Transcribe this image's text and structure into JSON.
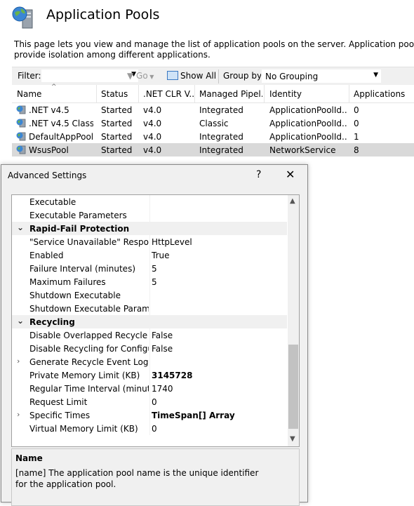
{
  "page": {
    "title": "Application Pools",
    "description_line1": "This page lets you view and manage the list of application pools on the server. Application pools are associat",
    "description_line2": "provide isolation among different applications."
  },
  "toolbar": {
    "filter_label": "Filter:",
    "filter_value": "",
    "go_label": "Go",
    "show_all_label": "Show All",
    "group_by_label": "Group by:",
    "group_by_value": "No Grouping"
  },
  "grid": {
    "columns": [
      "Name",
      "Status",
      ".NET CLR V...",
      "Managed Pipel...",
      "Identity",
      "Applications"
    ],
    "rows": [
      {
        "name": ".NET v4.5",
        "status": "Started",
        "clr": "v4.0",
        "pipeline": "Integrated",
        "identity": "ApplicationPoolId...",
        "apps": "0"
      },
      {
        "name": ".NET v4.5 Classic",
        "status": "Started",
        "clr": "v4.0",
        "pipeline": "Classic",
        "identity": "ApplicationPoolId...",
        "apps": "0"
      },
      {
        "name": "DefaultAppPool",
        "status": "Started",
        "clr": "v4.0",
        "pipeline": "Integrated",
        "identity": "ApplicationPoolId...",
        "apps": "1"
      },
      {
        "name": "WsusPool",
        "status": "Started",
        "clr": "v4.0",
        "pipeline": "Integrated",
        "identity": "NetworkService",
        "apps": "8"
      }
    ]
  },
  "dialog": {
    "title": "Advanced Settings",
    "help_glyph": "?",
    "close_glyph": "✕",
    "properties": [
      {
        "name": "Executable",
        "value": ""
      },
      {
        "name": "Executable Parameters",
        "value": ""
      },
      {
        "name": "Rapid-Fail Protection",
        "value": "",
        "category": true,
        "expander": "⌄"
      },
      {
        "name": "\"Service Unavailable\" Response Type",
        "value": "HttpLevel"
      },
      {
        "name": "Enabled",
        "value": "True"
      },
      {
        "name": "Failure Interval (minutes)",
        "value": "5"
      },
      {
        "name": "Maximum Failures",
        "value": "5"
      },
      {
        "name": "Shutdown Executable",
        "value": ""
      },
      {
        "name": "Shutdown Executable Parameters",
        "value": ""
      },
      {
        "name": "Recycling",
        "value": "",
        "category": true,
        "expander": "⌄"
      },
      {
        "name": "Disable Overlapped Recycle",
        "value": "False"
      },
      {
        "name": "Disable Recycling for Configuration Changes",
        "value": "False"
      },
      {
        "name": "Generate Recycle Event Log Entry",
        "value": "",
        "expander": "›"
      },
      {
        "name": "Private Memory Limit (KB)",
        "value": "3145728",
        "bold": true
      },
      {
        "name": "Regular Time Interval (minutes)",
        "value": "1740"
      },
      {
        "name": "Request Limit",
        "value": "0"
      },
      {
        "name": "Specific Times",
        "value": "TimeSpan[] Array",
        "bold": true,
        "expander": "›"
      },
      {
        "name": "Virtual Memory Limit (KB)",
        "value": "0"
      }
    ],
    "description_title": "Name",
    "description_text": "[name] The application pool name is the unique identifier for the application pool."
  },
  "icons": {
    "header": "server-globe-icon",
    "pool": "app-pool-icon",
    "go": "funnel-icon",
    "show_all": "show-all-icon"
  },
  "colors": {
    "selected_row": "#d9d9d9",
    "toolbar_bg": "#f0f0f0",
    "category_bg": "#f0f0f0"
  }
}
